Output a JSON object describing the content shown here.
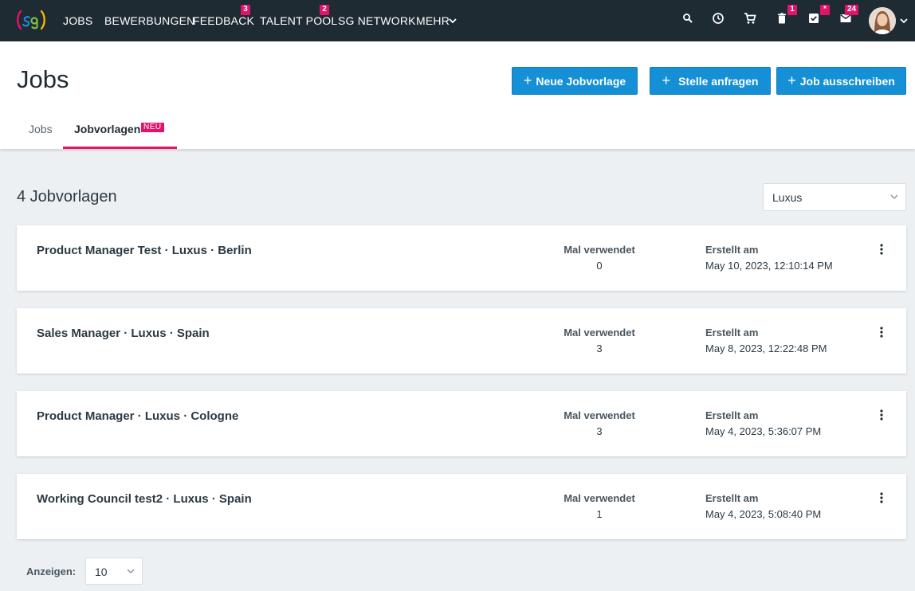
{
  "nav": {
    "items": [
      {
        "label": "JOBS"
      },
      {
        "label": "BEWERBUNGEN"
      },
      {
        "label": "FEEDBACK",
        "badge": "3"
      },
      {
        "label": "TALENT POOL",
        "badge": "2"
      },
      {
        "label": "SG NETWORK"
      },
      {
        "label": "MEHR"
      }
    ],
    "icons": [
      {
        "name": "search-icon"
      },
      {
        "name": "clock-icon"
      },
      {
        "name": "cart-icon"
      },
      {
        "name": "trash-icon",
        "badge": "1"
      },
      {
        "name": "task-check-icon",
        "badge": "*"
      },
      {
        "name": "mail-icon",
        "badge": "24"
      }
    ],
    "accent": "#e5126c",
    "background": "#1f2b33"
  },
  "header": {
    "title": "Jobs",
    "buttons": [
      {
        "label": "Neue Jobvorlage"
      },
      {
        "label": "Stelle anfragen"
      },
      {
        "label": "Job ausschreiben"
      }
    ],
    "tabs": [
      {
        "label": "Jobs",
        "active": false
      },
      {
        "label": "Jobvorlagen",
        "active": true,
        "badge": "NEU"
      }
    ],
    "button_color": "#1590d6"
  },
  "main": {
    "count_title": "4 Jobvorlagen",
    "filter": {
      "value": "Luxus"
    },
    "used_label": "Mal verwendet",
    "created_label": "Erstellt am",
    "templates": [
      {
        "title": "Product Manager Test · Luxus · Berlin",
        "used": "0",
        "created": "May 10, 2023, 12:10:14 PM"
      },
      {
        "title": "Sales Manager · Luxus · Spain",
        "used": "3",
        "created": "May 8, 2023, 12:22:48 PM"
      },
      {
        "title": "Product Manager · Luxus · Cologne",
        "used": "3",
        "created": "May 4, 2023, 5:36:07 PM"
      },
      {
        "title": "Working Council test2 · Luxus · Spain",
        "used": "1",
        "created": "May 4, 2023, 5:08:40 PM"
      }
    ],
    "page_size": {
      "label": "Anzeigen:",
      "value": "10"
    }
  }
}
